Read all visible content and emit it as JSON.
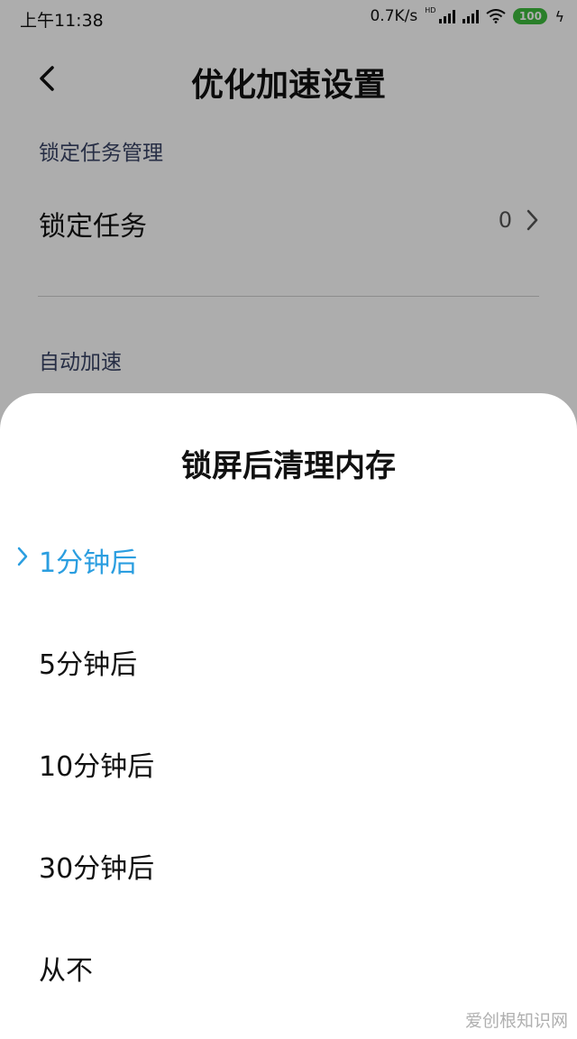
{
  "status_bar": {
    "time": "上午11:38",
    "speed": "0.7K/s",
    "hd": "HD",
    "battery": "100"
  },
  "header": {
    "title": "优化加速设置"
  },
  "settings": {
    "section1_label": "锁定任务管理",
    "lock_task_label": "锁定任务",
    "lock_task_value": "0",
    "section2_label": "自动加速"
  },
  "sheet": {
    "title": "锁屏后清理内存",
    "options": [
      {
        "label": "1分钟后",
        "selected": true
      },
      {
        "label": "5分钟后",
        "selected": false
      },
      {
        "label": "10分钟后",
        "selected": false
      },
      {
        "label": "30分钟后",
        "selected": false
      },
      {
        "label": "从不",
        "selected": false
      }
    ]
  },
  "watermark": "爱创根知识网",
  "colors": {
    "accent": "#2b9ee0",
    "battery": "#3dbb3d",
    "section_label": "#3a4566"
  },
  "icons": [
    "back-arrow-icon",
    "chevron-right-icon",
    "check-chevron-icon",
    "signal-icon",
    "wifi-icon",
    "battery-icon",
    "charging-bolt-icon"
  ]
}
